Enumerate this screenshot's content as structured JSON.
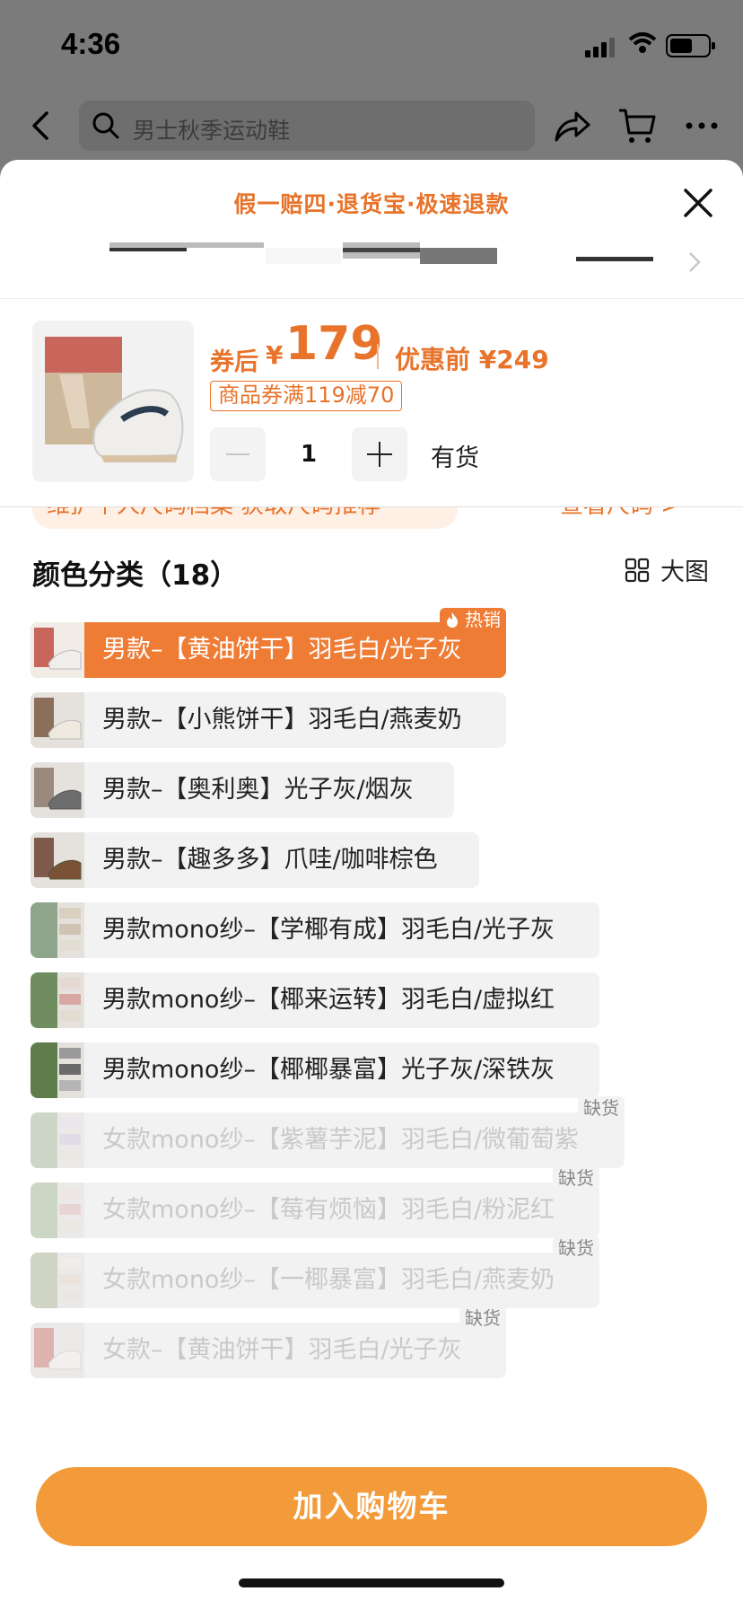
{
  "status": {
    "time": "4:36"
  },
  "nav": {
    "search_placeholder": "男士秋季运动鞋"
  },
  "sheet": {
    "promo": "假一赔四·退货宝·极速退款",
    "price": {
      "after_label": "券后",
      "currency": "¥",
      "after_value": "179",
      "before_label": "优惠前 ¥249",
      "coupon": "商品券满119减70",
      "quantity": "1",
      "stock": "有货"
    },
    "size_hint": "维护个人尺码档案 获取尺码推荐",
    "size_link": "查看尺码 >",
    "section_title": "颜色分类（18）",
    "big_view": "大图",
    "options": [
      {
        "label": "男款–【黄油饼干】羽毛白/光子灰",
        "badge": "热销",
        "state": "selected"
      },
      {
        "label": "男款–【小熊饼干】羽毛白/燕麦奶",
        "state": "normal"
      },
      {
        "label": "男款–【奥利奥】光子灰/烟灰",
        "state": "normal"
      },
      {
        "label": "男款–【趣多多】爪哇/咖啡棕色",
        "state": "normal"
      },
      {
        "label": "男款mono纱–【学椰有成】羽毛白/光子灰",
        "state": "normal"
      },
      {
        "label": "男款mono纱–【椰来运转】羽毛白/虚拟红",
        "state": "normal"
      },
      {
        "label": "男款mono纱–【椰椰暴富】光子灰/深铁灰",
        "state": "normal"
      },
      {
        "label": "女款mono纱–【紫薯芋泥】羽毛白/微葡萄紫",
        "badge": "缺货",
        "state": "disabled"
      },
      {
        "label": "女款mono纱–【莓有烦恼】羽毛白/粉泥红",
        "badge": "缺货",
        "state": "disabled"
      },
      {
        "label": "女款mono纱–【一椰暴富】羽毛白/燕麦奶",
        "badge": "缺货",
        "state": "disabled"
      },
      {
        "label": "女款–【黄油饼干】羽毛白/光子灰",
        "badge": "缺货",
        "state": "disabled"
      }
    ],
    "cart_button": "加入购物车"
  },
  "colors": {
    "accent": "#e8732a",
    "cart": "#f39a3a"
  }
}
